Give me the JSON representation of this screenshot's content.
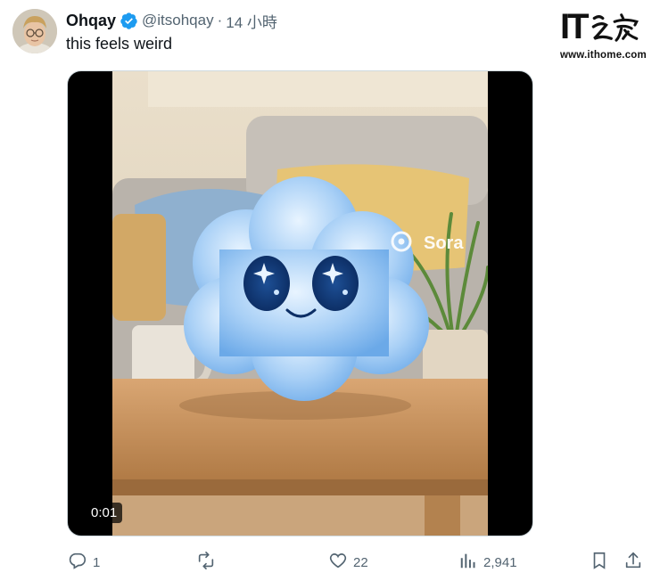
{
  "tweet": {
    "author_name": "Ohqay",
    "handle": "@itsohqay",
    "separator": "·",
    "time": "14 小時",
    "text": "this feels weird"
  },
  "media": {
    "timestamp": "0:01",
    "overlay_label": "Sora"
  },
  "actions": {
    "reply_count": "1",
    "repost_count": "",
    "like_count": "22",
    "view_count": "2,941"
  },
  "watermark": {
    "logo_text": "IT之家",
    "url": "www.ithome.com"
  },
  "icons": {
    "verified": "verified-badge-icon",
    "reply": "reply-icon",
    "repost": "repost-icon",
    "like": "like-icon",
    "views": "views-icon",
    "bookmark": "bookmark-icon",
    "share": "share-icon"
  },
  "colors": {
    "verified_blue": "#1d9bf0",
    "secondary_text": "#536471",
    "primary_text": "#0f1419"
  }
}
